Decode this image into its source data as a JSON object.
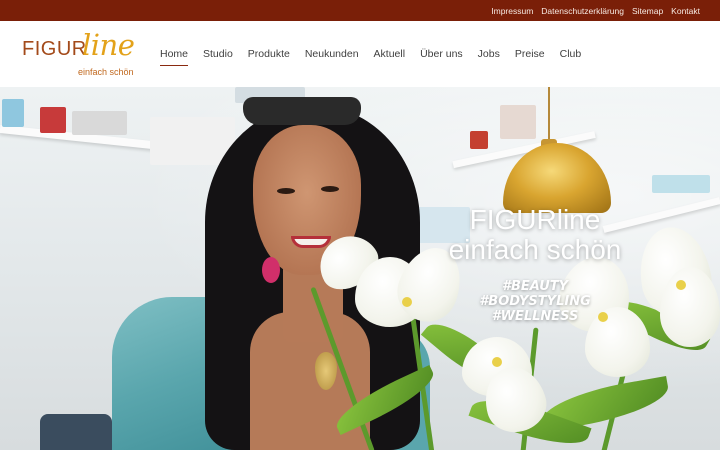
{
  "topbar": {
    "links": [
      "Impressum",
      "Datenschutzerklärung",
      "Sitemap",
      "Kontakt"
    ]
  },
  "logo": {
    "word": "FIGUR",
    "script": "line",
    "tagline": "einfach schön"
  },
  "nav": {
    "items": [
      "Home",
      "Studio",
      "Produkte",
      "Neukunden",
      "Aktuell",
      "Über uns",
      "Jobs",
      "Preise",
      "Club"
    ],
    "active": "Home"
  },
  "hero": {
    "title_line1": "FIGURline",
    "title_line2": "einfach schön",
    "hashtags": [
      "#BEAUTY",
      "#BODYSTYLING",
      "#WELLNESS"
    ]
  },
  "colors": {
    "topbar": "#7a1f08",
    "logo_dark": "#a34a1a",
    "logo_accent": "#e3a21a",
    "nav_text": "#3f3f3f"
  }
}
